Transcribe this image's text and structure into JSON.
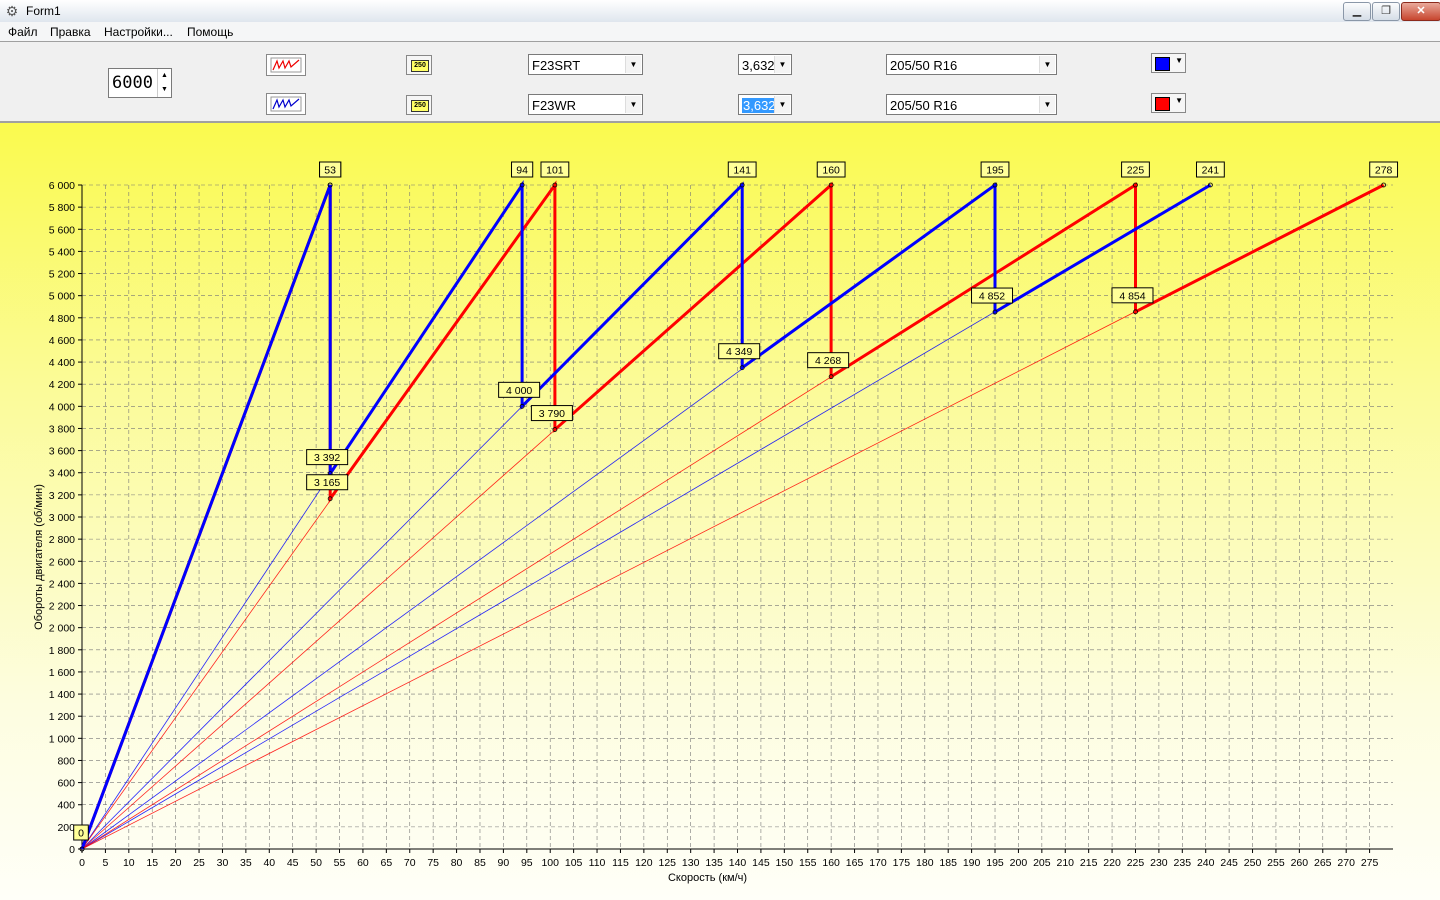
{
  "window": {
    "title": "Form1",
    "icon": "gear-icon"
  },
  "menu": [
    "Файл",
    "Правка",
    "Настройки...",
    "Помощь"
  ],
  "toolbar": {
    "max_rpm": "6000",
    "rows": [
      {
        "gearbox": "F23SRT",
        "final_drive": "3,632",
        "tire": "205/50 R16",
        "color": "#0000ff",
        "final_drive_selected": false
      },
      {
        "gearbox": "F23WR",
        "final_drive": "3,632",
        "tire": "205/50 R16",
        "color": "#ff0000",
        "final_drive_selected": true
      }
    ]
  },
  "chart_data": {
    "type": "line",
    "xlabel": "Скорость (км/ч)",
    "ylabel": "Обороты двигателя (об/мин)",
    "xlim": [
      0,
      280
    ],
    "ylim": [
      0,
      6000
    ],
    "x_ticks": [
      0,
      5,
      10,
      15,
      20,
      25,
      30,
      35,
      40,
      45,
      50,
      55,
      60,
      65,
      70,
      75,
      80,
      85,
      90,
      95,
      100,
      105,
      110,
      115,
      120,
      125,
      130,
      135,
      140,
      145,
      150,
      155,
      160,
      165,
      170,
      175,
      180,
      185,
      190,
      195,
      200,
      205,
      210,
      215,
      220,
      225,
      230,
      235,
      240,
      245,
      250,
      255,
      260,
      265,
      270,
      275
    ],
    "y_ticks": [
      "0",
      "200",
      "400",
      "600",
      "800",
      "1 000",
      "1 200",
      "1 400",
      "1 600",
      "1 800",
      "2 000",
      "2 200",
      "2 400",
      "2 600",
      "2 800",
      "3 000",
      "3 200",
      "3 400",
      "3 600",
      "3 800",
      "4 000",
      "4 200",
      "4 400",
      "4 600",
      "4 800",
      "5 000",
      "5 200",
      "5 400",
      "5 600",
      "5 800",
      "6 000"
    ],
    "grid": true,
    "series": [
      {
        "color": "#0000ff",
        "gear_top_speeds": [
          53,
          94,
          141,
          195,
          241
        ],
        "shift_rpms": [
          3392,
          4000,
          4349,
          4852
        ],
        "shift_labels": [
          "3 392",
          "4 000",
          "4 349",
          "4 852"
        ]
      },
      {
        "color": "#ff0000",
        "gear_top_speeds": [
          53,
          101,
          160,
          225,
          278
        ],
        "shift_rpms": [
          3165,
          3790,
          4268,
          4854
        ],
        "shift_labels": [
          "3 165",
          "3 790",
          "4 268",
          "4 854"
        ]
      }
    ],
    "max_rpm": 6000,
    "origin_label": "0",
    "top_labels": [
      "53",
      "94",
      "101",
      "141",
      "160",
      "195",
      "225",
      "241",
      "278"
    ]
  }
}
